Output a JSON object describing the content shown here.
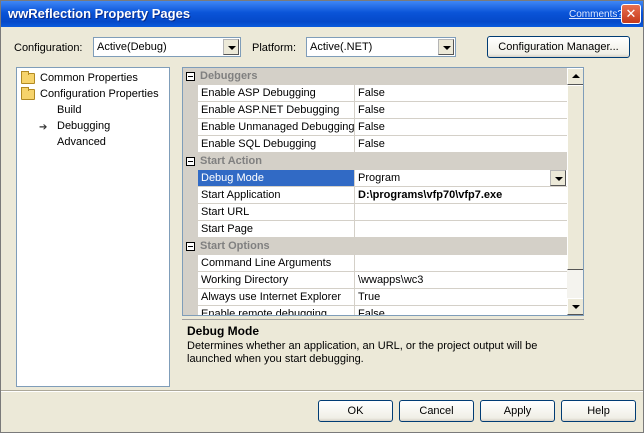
{
  "window": {
    "title": "wwReflection Property Pages",
    "comments_link": "Comments?",
    "close_glyph": "✕"
  },
  "config": {
    "configuration_label": "Configuration:",
    "configuration_value": "Active(Debug)",
    "platform_label": "Platform:",
    "platform_value": "Active(.NET)",
    "manager_button": "Configuration Manager..."
  },
  "tree": {
    "common": "Common Properties",
    "configuration": "Configuration Properties",
    "build": "Build",
    "debugging": "Debugging",
    "advanced": "Advanced"
  },
  "grid": {
    "cat_debuggers": "Debuggers",
    "cat_start_action": "Start Action",
    "cat_start_options": "Start Options",
    "rows": [
      {
        "name": "Enable ASP Debugging",
        "value": "False"
      },
      {
        "name": "Enable ASP.NET Debugging",
        "value": "False"
      },
      {
        "name": "Enable Unmanaged Debugging",
        "value": "False"
      },
      {
        "name": "Enable SQL Debugging",
        "value": "False"
      },
      {
        "name": "Debug Mode",
        "value": "Program"
      },
      {
        "name": "Start Application",
        "value": "D:\\programs\\vfp70\\vfp7.exe"
      },
      {
        "name": "Start URL",
        "value": ""
      },
      {
        "name": "Start Page",
        "value": ""
      },
      {
        "name": "Command Line Arguments",
        "value": ""
      },
      {
        "name": "Working Directory",
        "value": "\\wwapps\\wc3"
      },
      {
        "name": "Always use Internet Explorer",
        "value": "True"
      },
      {
        "name": "Enable remote debugging",
        "value": "False"
      }
    ]
  },
  "description": {
    "title": "Debug Mode",
    "text": "Determines whether an application, an URL, or the project output will be launched when you start debugging."
  },
  "buttons": {
    "ok": "OK",
    "cancel": "Cancel",
    "apply": "Apply",
    "help": "Help"
  }
}
